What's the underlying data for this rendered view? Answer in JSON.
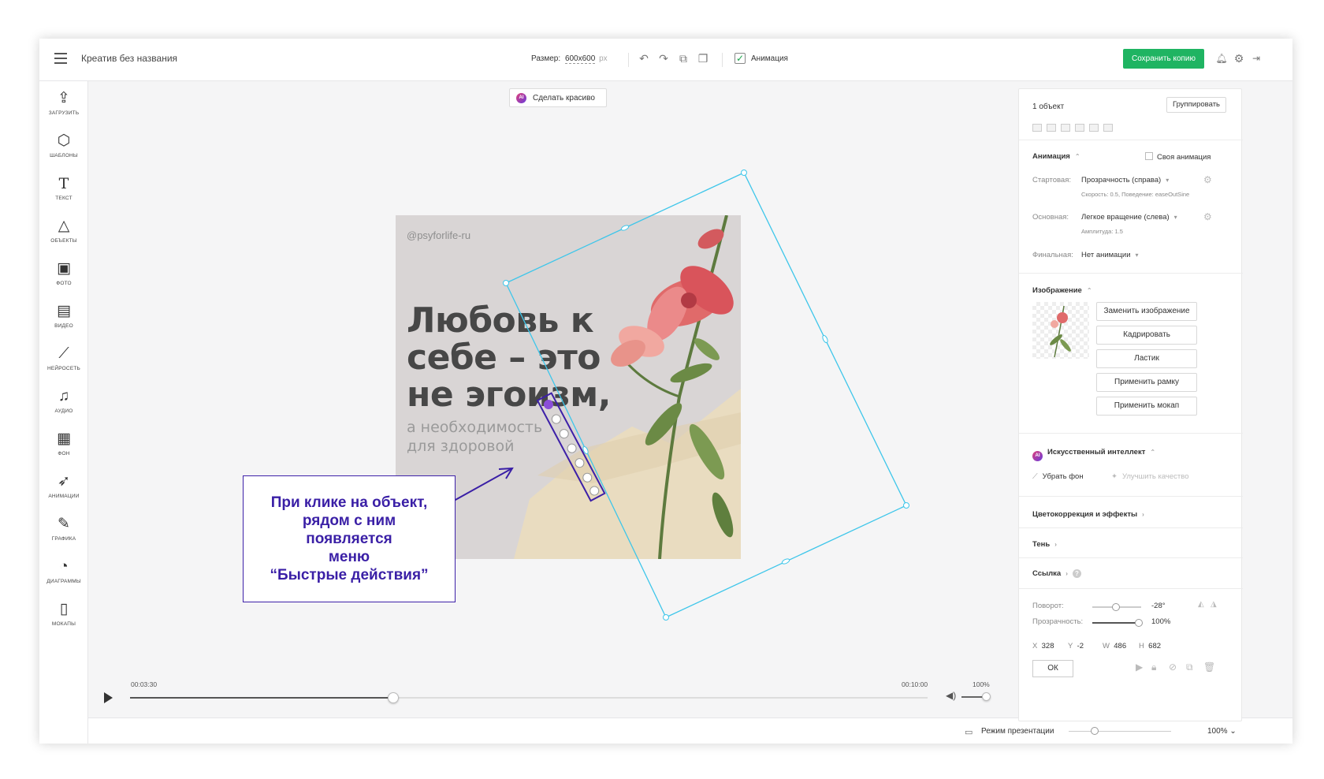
{
  "header": {
    "title": "Креатив без названия",
    "size_label": "Размер:",
    "size_value": "600x600",
    "size_unit": "px",
    "animation_label": "Анимация",
    "animation_checked": true,
    "save_label": "Сохранить копию"
  },
  "sidebar": {
    "items": [
      {
        "label": "ЗАГРУЗИТЬ",
        "icon": "upload-icon"
      },
      {
        "label": "ШАБЛОНЫ",
        "icon": "templates-icon"
      },
      {
        "label": "ТЕКСТ",
        "icon": "text-icon"
      },
      {
        "label": "ОБЪЕКТЫ",
        "icon": "shapes-icon"
      },
      {
        "label": "ФОТО",
        "icon": "photo-icon"
      },
      {
        "label": "ВИДЕО",
        "icon": "video-icon"
      },
      {
        "label": "НЕЙРОСЕТЬ",
        "icon": "magic-wand-icon"
      },
      {
        "label": "АУДИО",
        "icon": "music-icon"
      },
      {
        "label": "ФОН",
        "icon": "background-icon"
      },
      {
        "label": "АНИМАЦИИ",
        "icon": "rocket-icon"
      },
      {
        "label": "ГРАФИКА",
        "icon": "brush-icon"
      },
      {
        "label": "ДИАГРАММЫ",
        "icon": "pie-chart-icon"
      },
      {
        "label": "МОКАПЫ",
        "icon": "phone-icon"
      }
    ]
  },
  "canvas": {
    "make_pretty_label": "Сделать красиво",
    "ai_badge": "AI",
    "handle": "@psyforlife-ru",
    "headline_lines": [
      "Любовь к",
      "себе – это",
      "не эгоизм,"
    ],
    "subline_lines": [
      "а необходимость",
      "для здоровой"
    ],
    "callout_lines": [
      "При клике на объект,",
      "рядом с ним",
      "появляется",
      "меню",
      "“Быстрые действия”"
    ]
  },
  "timeline": {
    "current_time": "00:03:30",
    "total_time": "00:10:00",
    "volume": "100%",
    "progress": 0.33,
    "volume_level": 1.0
  },
  "bottombar": {
    "presentation_label": "Режим презентации",
    "zoom": "100%"
  },
  "panel": {
    "objects_count": "1 объект",
    "group_label": "Группировать",
    "animation": {
      "title": "Анимация",
      "custom_label": "Своя анимация",
      "start_label": "Стартовая:",
      "start_value": "Прозрачность (справа)",
      "start_details": "Скорость: 0.5, Поведение: easeOutSine",
      "main_label": "Основная:",
      "main_value": "Легкое вращение (слева)",
      "main_details": "Амплитуда: 1.5",
      "final_label": "Финальная:",
      "final_value": "Нет анимации"
    },
    "image": {
      "title": "Изображение",
      "buttons": [
        "Заменить изображение",
        "Кадрировать",
        "Ластик",
        "Применить рамку",
        "Применить мокап"
      ]
    },
    "ai": {
      "title": "Искусственный интеллект",
      "remove_bg": "Убрать фон",
      "improve": "Улучшить качество"
    },
    "sections": [
      "Цветокоррекция и эффекты",
      "Тень",
      "Ссылка"
    ],
    "rotation_label": "Поворот:",
    "rotation_value": "-28°",
    "opacity_label": "Прозрачность:",
    "opacity_value": "100%",
    "coords": {
      "x_label": "X",
      "x": "328",
      "y_label": "Y",
      "y": "-2",
      "w_label": "W",
      "w": "486",
      "h_label": "H",
      "h": "682"
    },
    "ok_label": "ОК"
  },
  "colors": {
    "accent_green": "#1fb462",
    "selection_cyan": "#3ec6ea",
    "callout_purple": "#3a1fa6"
  }
}
